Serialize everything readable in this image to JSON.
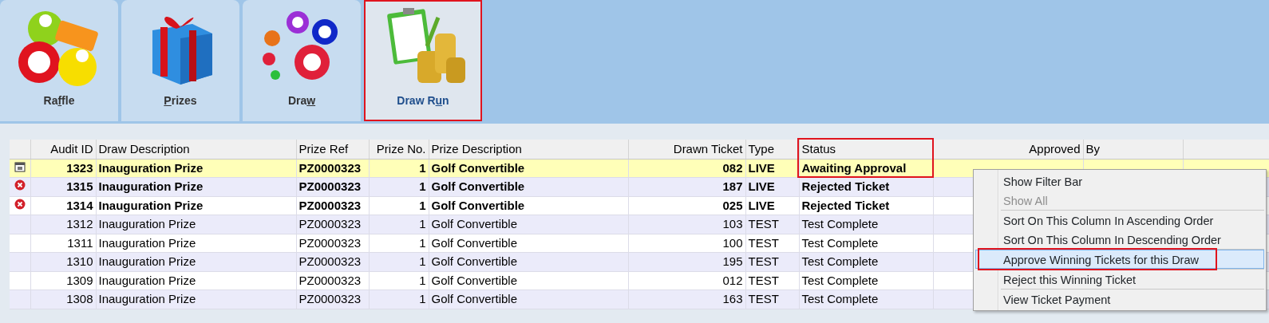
{
  "tabs": [
    {
      "label_parts": [
        {
          "text": "Ra",
          "underlined": false
        },
        {
          "text": "f",
          "underlined": true
        },
        {
          "text": "fle",
          "underlined": false
        }
      ],
      "selected": false,
      "highlighted": false
    },
    {
      "label_parts": [
        {
          "text": "P",
          "underlined": true
        },
        {
          "text": "rizes",
          "underlined": false
        }
      ],
      "selected": false,
      "highlighted": false
    },
    {
      "label_parts": [
        {
          "text": "Dra",
          "underlined": false
        },
        {
          "text": "w",
          "underlined": true
        }
      ],
      "selected": false,
      "highlighted": false
    },
    {
      "label_parts": [
        {
          "text": "Draw R",
          "underlined": false
        },
        {
          "text": "u",
          "underlined": true
        },
        {
          "text": "n",
          "underlined": false
        }
      ],
      "selected": true,
      "highlighted": true
    }
  ],
  "table": {
    "columns": [
      {
        "highlighted": false
      },
      {
        "label": "Audit ID",
        "highlighted": false
      },
      {
        "label": "Draw Description",
        "highlighted": false
      },
      {
        "label": "Prize Ref",
        "highlighted": false
      },
      {
        "label": "Prize No.",
        "highlighted": false
      },
      {
        "label": "Prize Description",
        "highlighted": false
      },
      {
        "label": "Drawn Ticket",
        "highlighted": false
      },
      {
        "label": "Type",
        "highlighted": false
      },
      {
        "label": "Status",
        "highlighted": true
      },
      {
        "label": "Approved",
        "highlighted": false
      },
      {
        "label": "By",
        "highlighted": false
      }
    ],
    "rows": [
      {
        "kind": "pending",
        "selected": true,
        "bold": true,
        "cells": [
          "",
          "1323",
          "Inauguration Prize",
          "PZ0000323",
          "1",
          "Golf Convertible",
          "082",
          "LIVE",
          "Awaiting Approval",
          "",
          ""
        ]
      },
      {
        "kind": "rejected",
        "selected": false,
        "bold": true,
        "cells": [
          "",
          "1315",
          "Inauguration Prize",
          "PZ0000323",
          "1",
          "Golf Convertible",
          "187",
          "LIVE",
          "Rejected Ticket",
          "",
          ""
        ]
      },
      {
        "kind": "rejected",
        "selected": false,
        "bold": true,
        "cells": [
          "",
          "1314",
          "Inauguration Prize",
          "PZ0000323",
          "1",
          "Golf Convertible",
          "025",
          "LIVE",
          "Rejected Ticket",
          "",
          ""
        ]
      },
      {
        "kind": "plain",
        "selected": false,
        "bold": false,
        "cells": [
          "",
          "1312",
          "Inauguration Prize",
          "PZ0000323",
          "1",
          "Golf Convertible",
          "103",
          "TEST",
          "Test Complete",
          "",
          ""
        ]
      },
      {
        "kind": "plain",
        "selected": false,
        "bold": false,
        "cells": [
          "",
          "1311",
          "Inauguration Prize",
          "PZ0000323",
          "1",
          "Golf Convertible",
          "100",
          "TEST",
          "Test Complete",
          "",
          ""
        ]
      },
      {
        "kind": "plain",
        "selected": false,
        "bold": false,
        "cells": [
          "",
          "1310",
          "Inauguration Prize",
          "PZ0000323",
          "1",
          "Golf Convertible",
          "195",
          "TEST",
          "Test Complete",
          "",
          ""
        ]
      },
      {
        "kind": "plain",
        "selected": false,
        "bold": false,
        "cells": [
          "",
          "1309",
          "Inauguration Prize",
          "PZ0000323",
          "1",
          "Golf Convertible",
          "012",
          "TEST",
          "Test Complete",
          "",
          ""
        ]
      },
      {
        "kind": "plain",
        "selected": false,
        "bold": false,
        "cells": [
          "",
          "1308",
          "Inauguration Prize",
          "PZ0000323",
          "1",
          "Golf Convertible",
          "163",
          "TEST",
          "Test Complete",
          "",
          ""
        ]
      }
    ]
  },
  "context_menu": {
    "items": [
      {
        "kind": "item",
        "label": "Show Filter Bar",
        "disabled": false,
        "selected": false,
        "highlighted": false
      },
      {
        "kind": "item",
        "label": "Show All",
        "disabled": true,
        "selected": false,
        "highlighted": false
      },
      {
        "kind": "separator"
      },
      {
        "kind": "item",
        "label": "Sort On This Column In Ascending Order",
        "disabled": false,
        "selected": false,
        "highlighted": false
      },
      {
        "kind": "item",
        "label": "Sort On This Column In Descending Order",
        "disabled": false,
        "selected": false,
        "highlighted": false
      },
      {
        "kind": "separator"
      },
      {
        "kind": "item",
        "label": "Approve Winning Tickets for this Draw",
        "disabled": false,
        "selected": true,
        "highlighted": true
      },
      {
        "kind": "separator"
      },
      {
        "kind": "item",
        "label": "Reject this Winning Ticket",
        "disabled": false,
        "selected": false,
        "highlighted": false
      },
      {
        "kind": "separator"
      },
      {
        "kind": "item",
        "label": "View Ticket Payment",
        "disabled": false,
        "selected": false,
        "highlighted": false
      }
    ]
  }
}
